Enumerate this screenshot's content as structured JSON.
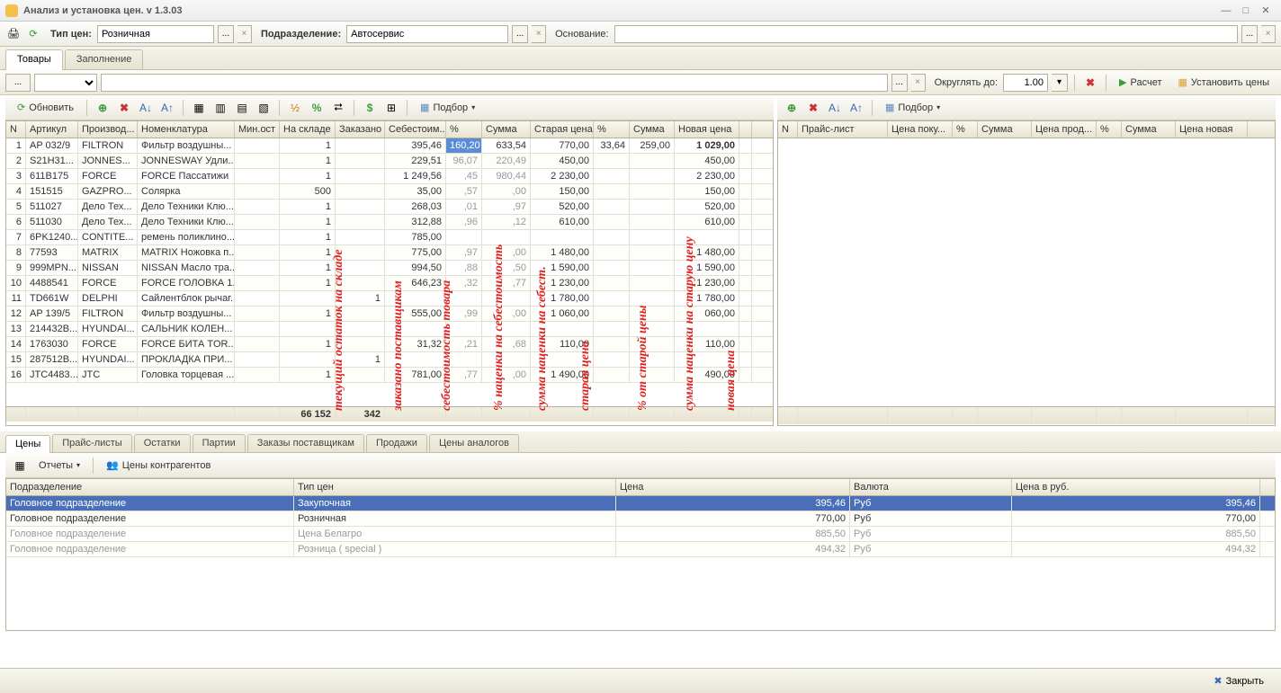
{
  "window": {
    "title": "Анализ и установка цен. v 1.3.03"
  },
  "topbar": {
    "price_type_label": "Тип цен:",
    "price_type_value": "Розничная",
    "dept_label": "Подразделение:",
    "dept_value": "Автосервис",
    "basis_label": "Основание:",
    "basis_value": ""
  },
  "tabs_top": {
    "goods": "Товары",
    "fill": "Заполнение"
  },
  "filterbar": {
    "round_label": "Округлять до:",
    "round_value": "1.00",
    "calc": "Расчет",
    "set_prices": "Установить цены"
  },
  "toolbar": {
    "refresh": "Обновить",
    "pick": "Подбор"
  },
  "grid1": {
    "headers": [
      "N",
      "Артикул",
      "Производ...",
      "Номенклатура",
      "Мин.ост",
      "На складе",
      "Заказано",
      "Себестоим...",
      "%",
      "Сумма",
      "Старая цена",
      "%",
      "Сумма",
      "Новая цена"
    ],
    "rows": [
      {
        "n": "1",
        "art": "AP 032/9",
        "prod": "FILTRON",
        "nom": "Фильтр воздушны...",
        "min": "",
        "stock": "1",
        "ord": "",
        "cost": "395,46",
        "pct": "160,20",
        "sum": "633,54",
        "old": "770,00",
        "pct2": "33,64",
        "sum2": "259,00",
        "newp": "1 029,00",
        "newbold": true,
        "sel": true
      },
      {
        "n": "2",
        "art": "S21H31...",
        "prod": "JONNES...",
        "nom": "JONNESWAY Удли...",
        "min": "",
        "stock": "1",
        "ord": "",
        "cost": "229,51",
        "pct": "96,07",
        "sum": "220,49",
        "old": "450,00",
        "pct2": "",
        "sum2": "",
        "newp": "450,00"
      },
      {
        "n": "3",
        "art": "611B175",
        "prod": "FORCE",
        "nom": "FORCE Пассатижи",
        "min": "",
        "stock": "1",
        "ord": "",
        "cost": "1 249,56",
        "pct": ",45",
        "sum": "980,44",
        "old": "2 230,00",
        "pct2": "",
        "sum2": "",
        "newp": "2 230,00"
      },
      {
        "n": "4",
        "art": "151515",
        "prod": "GAZPRO...",
        "nom": "Солярка",
        "min": "",
        "stock": "500",
        "ord": "",
        "cost": "35,00",
        "pct": ",57",
        "sum": ",00",
        "old": "150,00",
        "pct2": "",
        "sum2": "",
        "newp": "150,00"
      },
      {
        "n": "5",
        "art": "511027",
        "prod": "Дело Тех...",
        "nom": "Дело Техники Клю...",
        "min": "",
        "stock": "1",
        "ord": "",
        "cost": "268,03",
        "pct": ",01",
        "sum": ",97",
        "old": "520,00",
        "pct2": "",
        "sum2": "",
        "newp": "520,00"
      },
      {
        "n": "6",
        "art": "511030",
        "prod": "Дело Тех...",
        "nom": "Дело Техники Клю...",
        "min": "",
        "stock": "1",
        "ord": "",
        "cost": "312,88",
        "pct": ",96",
        "sum": ",12",
        "old": "610,00",
        "pct2": "",
        "sum2": "",
        "newp": "610,00"
      },
      {
        "n": "7",
        "art": "6PK1240...",
        "prod": "CONTITE...",
        "nom": "ремень поликлино...",
        "min": "",
        "stock": "1",
        "ord": "",
        "cost": "785,00",
        "pct": "",
        "sum": "",
        "old": "",
        "pct2": "",
        "sum2": "",
        "newp": ""
      },
      {
        "n": "8",
        "art": "77593",
        "prod": "MATRIX",
        "nom": "MATRIX Ножовка п...",
        "min": "",
        "stock": "1",
        "ord": "",
        "cost": "775,00",
        "pct": ",97",
        "sum": ",00",
        "old": "1 480,00",
        "pct2": "",
        "sum2": "",
        "newp": "1 480,00"
      },
      {
        "n": "9",
        "art": "999MPN...",
        "prod": "NISSAN",
        "nom": "NISSAN Масло тра...",
        "min": "",
        "stock": "1",
        "ord": "",
        "cost": "994,50",
        "pct": ",88",
        "sum": ",50",
        "old": "1 590,00",
        "pct2": "",
        "sum2": "",
        "newp": "1 590,00"
      },
      {
        "n": "10",
        "art": "4488541",
        "prod": "FORCE",
        "nom": "FORCE ГОЛОВКА 1...",
        "min": "",
        "stock": "1",
        "ord": "",
        "cost": "646,23",
        "pct": ",32",
        "sum": ",77",
        "old": "1 230,00",
        "pct2": "",
        "sum2": "",
        "newp": "1 230,00"
      },
      {
        "n": "11",
        "art": "TD661W",
        "prod": "DELPHI",
        "nom": "Сайлентблок рычаг...",
        "min": "",
        "stock": "",
        "ord": "1",
        "cost": "",
        "pct": "",
        "sum": "",
        "old": "1 780,00",
        "pct2": "",
        "sum2": "",
        "newp": "1 780,00"
      },
      {
        "n": "12",
        "art": "AP 139/5",
        "prod": "FILTRON",
        "nom": "Фильтр воздушны...",
        "min": "",
        "stock": "1",
        "ord": "",
        "cost": "555,00",
        "pct": ",99",
        "sum": ",00",
        "old": "1 060,00",
        "pct2": "",
        "sum2": "",
        "newp": "060,00"
      },
      {
        "n": "13",
        "art": "214432B...",
        "prod": "HYUNDAI...",
        "nom": "САЛЬНИК КОЛЕН...",
        "min": "",
        "stock": "",
        "ord": "",
        "cost": "",
        "pct": "",
        "sum": "",
        "old": "",
        "pct2": "",
        "sum2": "",
        "newp": ""
      },
      {
        "n": "14",
        "art": "1763030",
        "prod": "FORCE",
        "nom": "FORCE БИТА TOR...",
        "min": "",
        "stock": "1",
        "ord": "",
        "cost": "31,32",
        "pct": ",21",
        "sum": ",68",
        "old": "110,00",
        "pct2": "",
        "sum2": "",
        "newp": "110,00"
      },
      {
        "n": "15",
        "art": "287512B...",
        "prod": "HYUNDAI...",
        "nom": "ПРОКЛАДКА ПРИ...",
        "min": "",
        "stock": "",
        "ord": "1",
        "cost": "",
        "pct": "",
        "sum": "",
        "old": "",
        "pct2": "",
        "sum2": "",
        "newp": ""
      },
      {
        "n": "16",
        "art": "JTC4483...",
        "prod": "JTC",
        "nom": "Головка торцевая ...",
        "min": "",
        "stock": "1",
        "ord": "",
        "cost": "781,00",
        "pct": ",77",
        "sum": ",00",
        "old": "1 490,00",
        "pct2": "",
        "sum2": "",
        "newp": "490,00"
      }
    ],
    "footer": {
      "stock": "66 152",
      "ord": "342"
    }
  },
  "overlay_labels": {
    "l1": "текущий остаток на складе",
    "l2": "заказано поставщикам",
    "l3": "себестоимость товара",
    "l4": "% наценки на себестоимость",
    "l5": "сумма наценки на себест.",
    "l6": "старая цена",
    "l7": "% от старой цены",
    "l8": "сумма наценки на старую цену",
    "l9": "новая цена"
  },
  "grid2": {
    "headers": [
      "N",
      "Прайс-лист",
      "Цена поку...",
      "%",
      "Сумма",
      "Цена прод...",
      "%",
      "Сумма",
      "Цена новая"
    ]
  },
  "bottom_tabs": {
    "prices": "Цены",
    "pricelists": "Прайс-листы",
    "stock": "Остатки",
    "lots": "Партии",
    "orders": "Заказы поставщикам",
    "sales": "Продажи",
    "analog": "Цены аналогов"
  },
  "bottom_toolbar": {
    "reports": "Отчеты",
    "counter_prices": "Цены контрагентов"
  },
  "bottom_grid": {
    "headers": [
      "Подразделение",
      "Тип цен",
      "Цена",
      "Валюта",
      "Цена в руб."
    ],
    "rows": [
      {
        "dept": "Головное подразделение",
        "type": "Закупочная",
        "price": "395,46",
        "cur": "Руб",
        "rub": "395,46",
        "sel": true
      },
      {
        "dept": "Головное подразделение",
        "type": "Розничная",
        "price": "770,00",
        "cur": "Руб",
        "rub": "770,00"
      },
      {
        "dept": "Головное подразделение",
        "type": "Цена Белагро",
        "price": "885,50",
        "cur": "Руб",
        "rub": "885,50",
        "dim": true
      },
      {
        "dept": "Головное подразделение",
        "type": "Розница ( special )",
        "price": "494,32",
        "cur": "Руб",
        "rub": "494,32",
        "dim": true
      }
    ]
  },
  "footer": {
    "close": "Закрыть"
  }
}
